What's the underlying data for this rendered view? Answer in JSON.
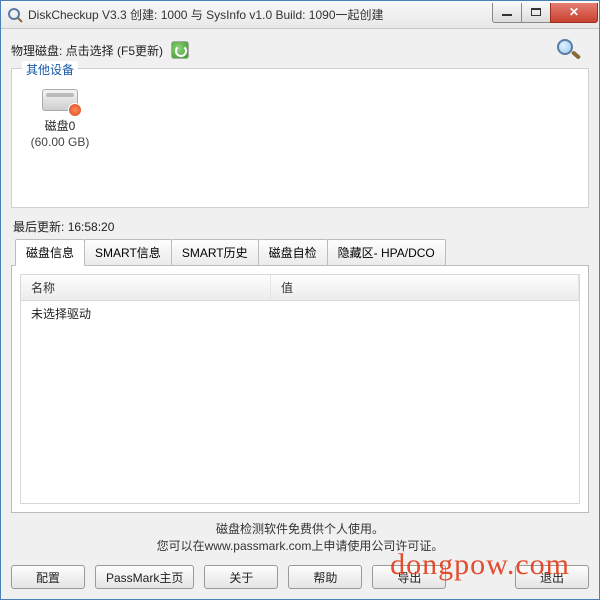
{
  "window": {
    "title": "DiskCheckup V3.3 创建: 1000 与 SysInfo v1.0 Build: 1090一起创建"
  },
  "toolbar": {
    "physical_disk_label": "物理磁盘: 点击选择 (F5更新)"
  },
  "devices": {
    "group_title": "其他设备",
    "items": [
      {
        "name": "磁盘0",
        "size": "(60.00 GB)"
      }
    ]
  },
  "status": {
    "last_update_label": "最后更新:",
    "last_update_time": "16:58:20"
  },
  "tabs": [
    {
      "label": "磁盘信息",
      "active": true
    },
    {
      "label": "SMART信息"
    },
    {
      "label": "SMART历史"
    },
    {
      "label": "磁盘自检"
    },
    {
      "label": "隐藏区- HPA/DCO"
    }
  ],
  "list": {
    "columns": [
      "名称",
      "值"
    ],
    "empty_text": "未选择驱动"
  },
  "footer": {
    "line1": "磁盘检测软件免费供个人使用。",
    "line2": "您可以在www.passmark.com上申请使用公司许可证。"
  },
  "buttons": {
    "config": "配置",
    "passmark": "PassMark主页",
    "about": "关于",
    "help": "帮助",
    "export": "导出",
    "exit": "退出"
  },
  "watermark": "dongpow.com"
}
